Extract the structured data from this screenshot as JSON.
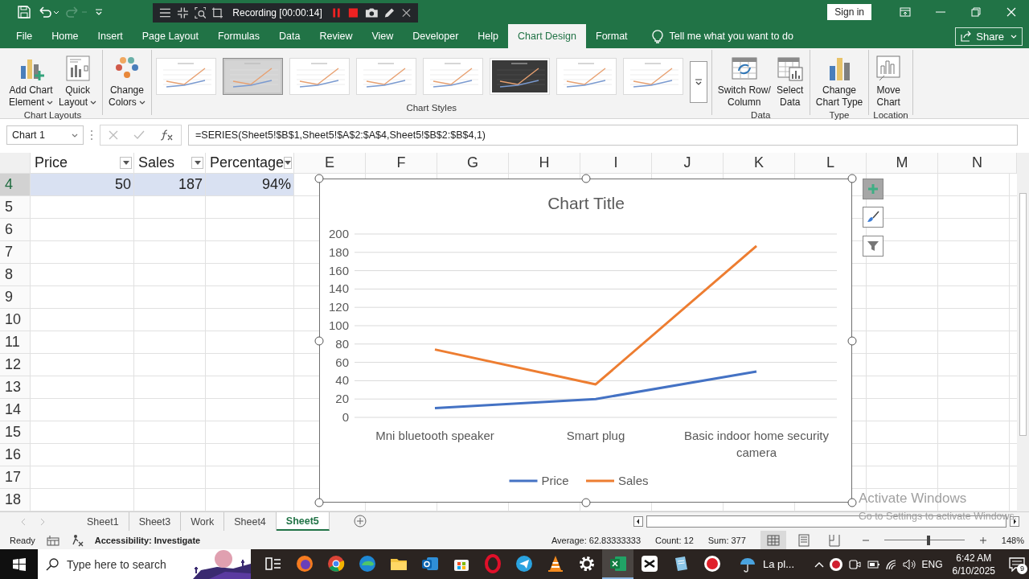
{
  "title_bar": {
    "recorder_status": "Recording [00:00:14]",
    "sign_in": "Sign in"
  },
  "tabs": [
    {
      "label": "File",
      "selected": false
    },
    {
      "label": "Home",
      "selected": false
    },
    {
      "label": "Insert",
      "selected": false
    },
    {
      "label": "Page Layout",
      "selected": false
    },
    {
      "label": "Formulas",
      "selected": false
    },
    {
      "label": "Data",
      "selected": false
    },
    {
      "label": "Review",
      "selected": false
    },
    {
      "label": "View",
      "selected": false
    },
    {
      "label": "Developer",
      "selected": false
    },
    {
      "label": "Help",
      "selected": false
    },
    {
      "label": "Chart Design",
      "selected": true
    },
    {
      "label": "Format",
      "selected": false
    }
  ],
  "tell_me": {
    "placeholder": "Tell me what you want to do"
  },
  "share": "Share",
  "ribbon": {
    "groups": [
      {
        "label": "Chart Layouts",
        "buttons": [
          {
            "kind": "add_element",
            "lines": [
              "Add Chart",
              "Element"
            ],
            "dropdown": true
          },
          {
            "kind": "quick_layout",
            "lines": [
              "Quick",
              "Layout"
            ],
            "dropdown": true
          }
        ]
      },
      {
        "buttons": [
          {
            "kind": "colors",
            "lines": [
              "Change",
              "Colors"
            ],
            "dropdown": true
          }
        ]
      },
      {
        "label": "Chart Styles",
        "styles": [
          {
            "selected": false,
            "dark": false
          },
          {
            "selected": true,
            "dark": false
          },
          {
            "selected": false,
            "dark": false
          },
          {
            "selected": false,
            "dark": false
          },
          {
            "selected": false,
            "dark": false
          },
          {
            "selected": false,
            "dark": true
          },
          {
            "selected": false,
            "dark": false
          },
          {
            "selected": false,
            "dark": false
          }
        ]
      },
      {
        "label": "Data",
        "buttons": [
          {
            "kind": "switch",
            "lines": [
              "Switch Row/",
              "Column"
            ],
            "dropdown": false
          },
          {
            "kind": "select_data",
            "lines": [
              "Select",
              "Data"
            ],
            "dropdown": false
          }
        ]
      },
      {
        "label": "Type",
        "buttons": [
          {
            "kind": "change_type",
            "lines": [
              "Change",
              "Chart Type"
            ],
            "dropdown": false
          }
        ]
      },
      {
        "label": "Location",
        "buttons": [
          {
            "kind": "move",
            "lines": [
              "Move",
              "Chart"
            ],
            "dropdown": false
          }
        ]
      }
    ]
  },
  "formula_bar": {
    "name_box": "Chart 1",
    "formula": "=SERIES(Sheet5!$B$1,Sheet5!$A$2:$A$4,Sheet5!$B$2:$B$4,1)"
  },
  "sheet": {
    "columns": [
      {
        "label": "Price",
        "filter": true
      },
      {
        "label": "Sales",
        "filter": true
      },
      {
        "label": "Percentage",
        "filter": true
      },
      {
        "label": "E",
        "filter": false
      },
      {
        "label": "F",
        "filter": false
      },
      {
        "label": "G",
        "filter": false
      },
      {
        "label": "H",
        "filter": false
      },
      {
        "label": "I",
        "filter": false
      },
      {
        "label": "J",
        "filter": false
      },
      {
        "label": "K",
        "filter": false
      },
      {
        "label": "L",
        "filter": false
      },
      {
        "label": "M",
        "filter": false
      },
      {
        "label": "N",
        "filter": false
      }
    ],
    "rows": [
      {
        "number": "4",
        "selected": true,
        "cells": [
          "50",
          "187",
          "94%"
        ]
      },
      {
        "number": "5",
        "selected": false
      },
      {
        "number": "6",
        "selected": false
      },
      {
        "number": "7",
        "selected": false
      },
      {
        "number": "8",
        "selected": false
      },
      {
        "number": "9",
        "selected": false
      },
      {
        "number": "10",
        "selected": false
      },
      {
        "number": "11",
        "selected": false
      },
      {
        "number": "12",
        "selected": false
      },
      {
        "number": "13",
        "selected": false
      },
      {
        "number": "14",
        "selected": false
      },
      {
        "number": "15",
        "selected": false
      },
      {
        "number": "16",
        "selected": false
      },
      {
        "number": "17",
        "selected": false
      },
      {
        "number": "18",
        "selected": false
      }
    ]
  },
  "chart": {
    "chart_data": {
      "type": "line",
      "title": "Chart Title",
      "categories": [
        "Mni bluetooth speaker",
        "Smart plug",
        "Basic indoor home security camera"
      ],
      "series": [
        {
          "name": "Price",
          "color": "#4472c4",
          "values": [
            10,
            20,
            50
          ]
        },
        {
          "name": "Sales",
          "color": "#ed7d31",
          "values": [
            74,
            36,
            187
          ]
        }
      ],
      "ylim": [
        0,
        200
      ],
      "yticks": [
        0,
        20,
        40,
        60,
        80,
        100,
        120,
        140,
        160,
        180,
        200
      ],
      "grid": true,
      "legend": true
    }
  },
  "sheet_tabs": [
    {
      "label": "Sheet1",
      "selected": false
    },
    {
      "label": "Sheet3",
      "selected": false
    },
    {
      "label": "Work",
      "selected": false
    },
    {
      "label": "Sheet4",
      "selected": false
    },
    {
      "label": "Sheet5",
      "selected": true
    }
  ],
  "status_bar": {
    "mode": "Ready",
    "accessibility": "Accessibility: Investigate",
    "average": "Average: 62.83333333",
    "count": "Count: 12",
    "sum": "Sum: 377",
    "views": [
      {
        "kind": "normal",
        "selected": true
      },
      {
        "kind": "page_layout",
        "selected": false
      },
      {
        "kind": "page_break",
        "selected": false
      }
    ],
    "zoom": {
      "level": 0.55,
      "reading": "148%"
    }
  },
  "activation_notice": {
    "title": "Activate Windows",
    "hint": "Go to Settings to activate Windows."
  },
  "taskbar": {
    "search": {
      "placeholder": "Type here to search"
    },
    "apps": [
      {
        "kind": "task_view",
        "active": false
      },
      {
        "kind": "firefox",
        "active": false
      },
      {
        "kind": "chrome",
        "active": false
      },
      {
        "kind": "edge",
        "active": false
      },
      {
        "kind": "files",
        "active": false
      },
      {
        "kind": "mail",
        "active": false
      },
      {
        "kind": "store",
        "active": false
      },
      {
        "kind": "opera",
        "active": false
      },
      {
        "kind": "telegram",
        "active": false
      },
      {
        "kind": "vlc",
        "active": false
      },
      {
        "kind": "settings",
        "active": false
      },
      {
        "kind": "excel",
        "active": true
      },
      {
        "kind": "capcut",
        "active": false
      },
      {
        "kind": "notepad",
        "active": false
      },
      {
        "kind": "recorder",
        "active": false
      }
    ],
    "weather": "La pl...",
    "language": "ENG",
    "time": "6:42 AM",
    "date": "6/10/2025",
    "notifications": "9"
  }
}
